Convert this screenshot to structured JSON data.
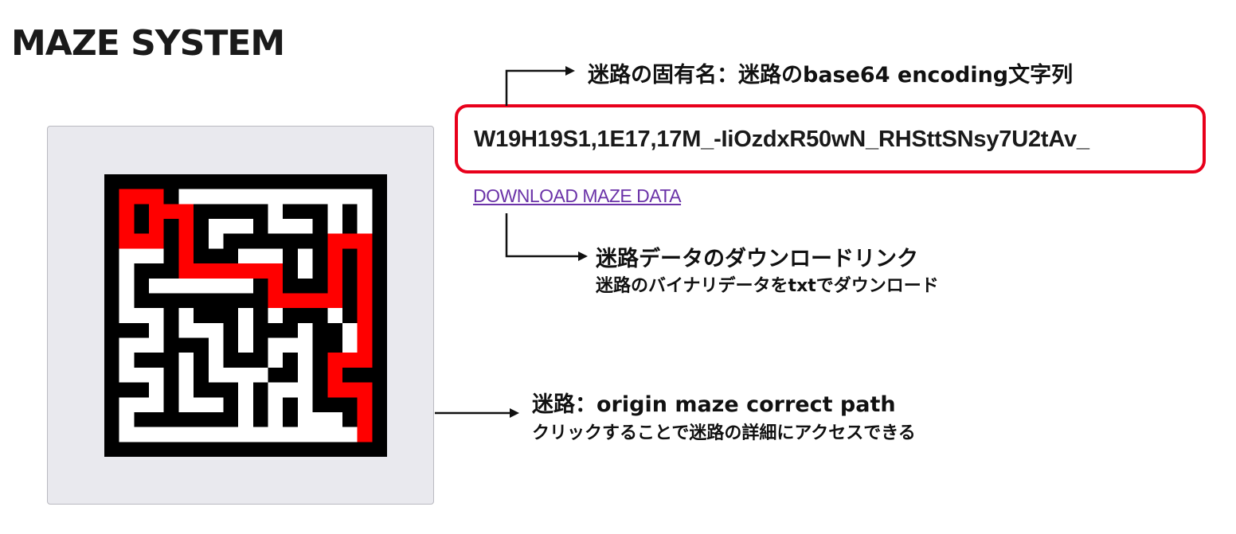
{
  "header": {
    "title": "MAZE SYSTEM"
  },
  "maze": {
    "wall_color": "#000000",
    "path_color": "#ffffff",
    "solution_color": "#ff0000",
    "card_color": "#e9e9ee"
  },
  "maze_name": {
    "value": "W19H19S1,1E17,17M_-IiOzdxR50wN_RHSttSNsy7U2tAv_"
  },
  "download_link": {
    "label": "DOWNLOAD MAZE DATA"
  },
  "annotations": {
    "name": {
      "title": "迷路の固有名：迷路のbase64 encoding文字列"
    },
    "download": {
      "title": "迷路データのダウンロードリンク",
      "subtitle": "迷路のバイナリデータをtxtでダウンロード"
    },
    "maze": {
      "title": "迷路：origin maze correct path",
      "subtitle": "クリックすることで迷路の詳細にアクセスできる"
    }
  },
  "colors": {
    "highlight_border": "#e8001b",
    "link": "#6b33a8"
  }
}
